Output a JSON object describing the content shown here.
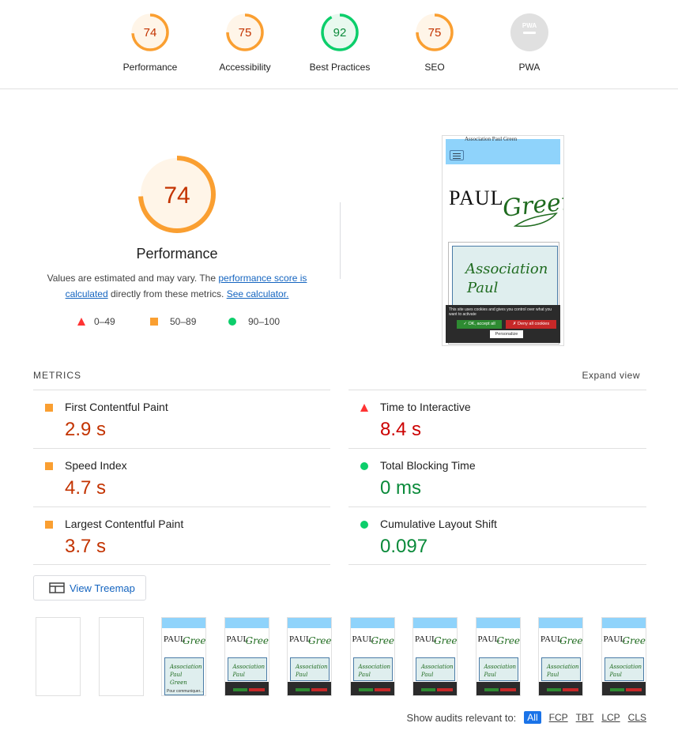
{
  "colors": {
    "orange": "#fa9f31",
    "orange_text": "#c33300",
    "green": "#0cce6b",
    "green_text": "#0a8a3a",
    "red": "#ff3333",
    "red_text": "#cc0000",
    "pwa_grey": "#9e9e9e"
  },
  "top_gauges": [
    {
      "score": "74",
      "label": "Performance",
      "value": 0.74,
      "color": "orange"
    },
    {
      "score": "75",
      "label": "Accessibility",
      "value": 0.75,
      "color": "orange"
    },
    {
      "score": "92",
      "label": "Best Practices",
      "value": 0.92,
      "color": "green"
    },
    {
      "score": "75",
      "label": "SEO",
      "value": 0.75,
      "color": "orange"
    },
    {
      "score": "",
      "label": "PWA",
      "value": 0,
      "color": "grey",
      "badge": "PWA"
    }
  ],
  "main": {
    "score": "74",
    "value": 0.74,
    "title": "Performance",
    "desc_prefix": "Values are estimated and may vary. The ",
    "desc_link1": "performance score is calculated",
    "desc_mid": " directly from these metrics. ",
    "desc_link2": "See calculator.",
    "legend": [
      {
        "icon": "triangle-icon",
        "range": "0–49"
      },
      {
        "icon": "square-icon",
        "range": "50–89"
      },
      {
        "icon": "circle-icon",
        "range": "90–100"
      }
    ]
  },
  "screenshot": {
    "site_title": "Association Paul Green",
    "logo_paul": "PAUL",
    "logo_green": "Green",
    "banner_line1": "Association",
    "banner_line2": "Paul",
    "cookie_text": "This site uses cookies and gives you control over what you want to activate",
    "accept": "✓ OK, accept all",
    "deny": "✗ Deny all cookies",
    "personalize": "Personalize"
  },
  "metrics": {
    "heading": "METRICS",
    "expand": "Expand view",
    "items": [
      {
        "label": "First Contentful Paint",
        "value": "2.9 s",
        "status": "orange"
      },
      {
        "label": "Time to Interactive",
        "value": "8.4 s",
        "status": "red"
      },
      {
        "label": "Speed Index",
        "value": "4.7 s",
        "status": "orange"
      },
      {
        "label": "Total Blocking Time",
        "value": "0 ms",
        "status": "green"
      },
      {
        "label": "Largest Contentful Paint",
        "value": "3.7 s",
        "status": "orange"
      },
      {
        "label": "Cumulative Layout Shift",
        "value": "0.097",
        "status": "green"
      }
    ]
  },
  "treemap": {
    "label": "View Treemap"
  },
  "filmstrip": {
    "count": 10,
    "blank_frames": 2,
    "thumb_paul": "PAUL",
    "thumb_green": "Green",
    "thumb_assoc": "Association",
    "thumb_paul2": "Paul",
    "thumb_green2": "Green",
    "thumb_small": "Pour communiquer..."
  },
  "filter": {
    "label": "Show audits relevant to:",
    "options": [
      "All",
      "FCP",
      "TBT",
      "LCP",
      "CLS"
    ]
  }
}
